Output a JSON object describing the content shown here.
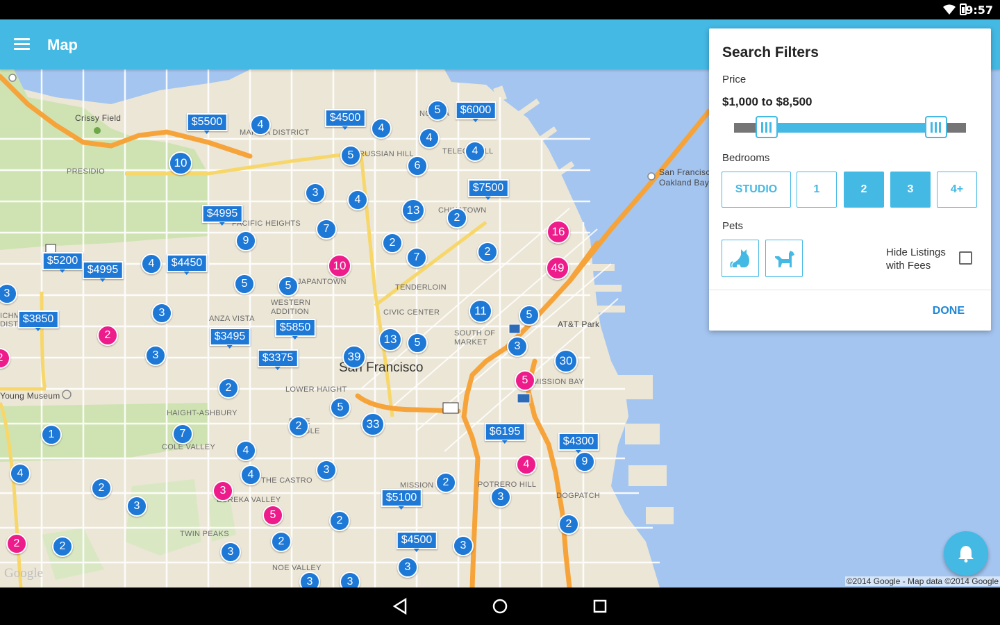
{
  "status_bar": {
    "time": "9:57",
    "icons": [
      "wifi-icon",
      "battery-icon"
    ]
  },
  "app_bar": {
    "title": "Map",
    "menu_icon": "hamburger-menu-icon",
    "color": "#44b9e4"
  },
  "map": {
    "labels": {
      "san_francisco": "San Francisco",
      "crissy_field": "Crissy Field",
      "presidio": "PRESIDIO",
      "marina_district": "MARINA DISTRICT",
      "russian_hill": "RUSSIAN HILL",
      "telegraph_hill": "TELEGR  HILL",
      "north_beach": "NO  BEA",
      "pacific_heights": "PACIFIC HEIGHTS",
      "chinatown": "CHINATOWN",
      "japantown": "JAPANTOWN",
      "tenderloin": "TENDERLOIN",
      "western_addition": "WESTERN\nADDITION",
      "civic_center": "CIVIC CENTER",
      "anza_vista": "ANZA VISTA",
      "south_of_market": "SOUTH OF\nMARKET",
      "att_park": "AT&T Park",
      "mission_bay": "MISSION BAY",
      "lower_haight": "LOWER HAIGHT",
      "haight_ashbury": "HAIGHT-ASHBURY",
      "cole_valley": "COLE VALLEY",
      "duboce_triangle": "D  CE\nT  NGLE",
      "the_castro": "THE CASTRO",
      "eureka_valley": "EUREKA VALLEY",
      "twin_peaks": "TWIN PEAKS",
      "noe_valley": "NOE VALLEY",
      "mission": "MISSION",
      "potrero_hill": "POTRERO HILL",
      "dogpatch": "DOGPATCH",
      "young_museum": "Young Museum",
      "bay_bridge": "San Francisc\nOakland Bay",
      "richmond": "ICHM\nDISTR"
    },
    "markers": [
      {
        "t": "$5500",
        "k": "price",
        "c": "blue"
      },
      {
        "t": "4",
        "k": "count",
        "c": "blue"
      },
      {
        "t": "$4500",
        "k": "price",
        "c": "blue"
      },
      {
        "t": "5",
        "k": "count",
        "c": "blue"
      },
      {
        "t": "$6000",
        "k": "price",
        "c": "blue"
      },
      {
        "t": "4",
        "k": "count",
        "c": "blue"
      },
      {
        "t": "4",
        "k": "count",
        "c": "blue"
      },
      {
        "t": "10",
        "k": "count",
        "c": "blue"
      },
      {
        "t": "5",
        "k": "count",
        "c": "blue"
      },
      {
        "t": "4",
        "k": "count",
        "c": "blue"
      },
      {
        "t": "6",
        "k": "count",
        "c": "blue"
      },
      {
        "t": "$7500",
        "k": "price",
        "c": "blue"
      },
      {
        "t": "3",
        "k": "count",
        "c": "blue"
      },
      {
        "t": "4",
        "k": "count",
        "c": "blue"
      },
      {
        "t": "$4995",
        "k": "price",
        "c": "blue"
      },
      {
        "t": "13",
        "k": "count",
        "c": "blue"
      },
      {
        "t": "7",
        "k": "count",
        "c": "blue"
      },
      {
        "t": "2",
        "k": "count",
        "c": "blue"
      },
      {
        "t": "9",
        "k": "count",
        "c": "blue"
      },
      {
        "t": "2",
        "k": "count",
        "c": "blue"
      },
      {
        "t": "16",
        "k": "count",
        "c": "pink"
      },
      {
        "t": "$5200",
        "k": "price",
        "c": "blue"
      },
      {
        "t": "$4995",
        "k": "price",
        "c": "blue"
      },
      {
        "t": "4",
        "k": "count",
        "c": "blue"
      },
      {
        "t": "$4450",
        "k": "price",
        "c": "blue"
      },
      {
        "t": "10",
        "k": "count",
        "c": "pink"
      },
      {
        "t": "7",
        "k": "count",
        "c": "blue"
      },
      {
        "t": "2",
        "k": "count",
        "c": "blue"
      },
      {
        "t": "49",
        "k": "count",
        "c": "pink"
      },
      {
        "t": "5",
        "k": "count",
        "c": "blue"
      },
      {
        "t": "5",
        "k": "count",
        "c": "blue"
      },
      {
        "t": "3",
        "k": "count",
        "c": "blue"
      },
      {
        "t": "11",
        "k": "count",
        "c": "blue"
      },
      {
        "t": "5",
        "k": "count",
        "c": "blue"
      },
      {
        "t": "3",
        "k": "count",
        "c": "blue"
      },
      {
        "t": "$3850",
        "k": "price",
        "c": "blue"
      },
      {
        "t": "2",
        "k": "count",
        "c": "pink"
      },
      {
        "t": "$5850",
        "k": "price",
        "c": "blue"
      },
      {
        "t": "$3495",
        "k": "price",
        "c": "blue"
      },
      {
        "t": "13",
        "k": "count",
        "c": "blue"
      },
      {
        "t": "5",
        "k": "count",
        "c": "blue"
      },
      {
        "t": "3",
        "k": "count",
        "c": "blue"
      },
      {
        "t": "3",
        "k": "count",
        "c": "blue"
      },
      {
        "t": "$3375",
        "k": "price",
        "c": "blue"
      },
      {
        "t": "39",
        "k": "count",
        "c": "blue"
      },
      {
        "t": "30",
        "k": "count",
        "c": "blue"
      },
      {
        "t": "2",
        "k": "count",
        "c": "pink"
      },
      {
        "t": "5",
        "k": "count",
        "c": "pink"
      },
      {
        "t": "2",
        "k": "count",
        "c": "blue"
      },
      {
        "t": "5",
        "k": "count",
        "c": "blue"
      },
      {
        "t": "33",
        "k": "count",
        "c": "blue"
      },
      {
        "t": "2",
        "k": "count",
        "c": "blue"
      },
      {
        "t": "1",
        "k": "count",
        "c": "blue"
      },
      {
        "t": "7",
        "k": "count",
        "c": "blue"
      },
      {
        "t": "$6195",
        "k": "price",
        "c": "blue"
      },
      {
        "t": "$4300",
        "k": "price",
        "c": "blue"
      },
      {
        "t": "4",
        "k": "count",
        "c": "blue"
      },
      {
        "t": "4",
        "k": "count",
        "c": "pink"
      },
      {
        "t": "9",
        "k": "count",
        "c": "blue"
      },
      {
        "t": "4",
        "k": "count",
        "c": "blue"
      },
      {
        "t": "4",
        "k": "count",
        "c": "blue"
      },
      {
        "t": "3",
        "k": "count",
        "c": "blue"
      },
      {
        "t": "2",
        "k": "count",
        "c": "blue"
      },
      {
        "t": "3",
        "k": "count",
        "c": "pink"
      },
      {
        "t": "2",
        "k": "count",
        "c": "blue"
      },
      {
        "t": "$5100",
        "k": "price",
        "c": "blue"
      },
      {
        "t": "3",
        "k": "count",
        "c": "blue"
      },
      {
        "t": "5",
        "k": "count",
        "c": "pink"
      },
      {
        "t": "3",
        "k": "count",
        "c": "blue"
      },
      {
        "t": "2",
        "k": "count",
        "c": "blue"
      },
      {
        "t": "2",
        "k": "count",
        "c": "blue"
      },
      {
        "t": "2",
        "k": "count",
        "c": "blue"
      },
      {
        "t": "2",
        "k": "count",
        "c": "pink"
      },
      {
        "t": "$4500",
        "k": "price",
        "c": "blue"
      },
      {
        "t": "3",
        "k": "count",
        "c": "blue"
      },
      {
        "t": "2",
        "k": "count",
        "c": "blue"
      },
      {
        "t": "3",
        "k": "count",
        "c": "blue"
      },
      {
        "t": "3",
        "k": "count",
        "c": "blue"
      },
      {
        "t": "3",
        "k": "count",
        "c": "blue"
      },
      {
        "t": "3",
        "k": "count",
        "c": "blue"
      },
      {
        "t": "2",
        "k": "count",
        "c": "pink"
      }
    ],
    "copyright": "©2014 Google - Map data ©2014 Google",
    "google_logo": "Google"
  },
  "filters": {
    "title": "Search Filters",
    "price_label": "Price",
    "price_range": "$1,000 to $8,500",
    "price_min_fraction": 0.14,
    "price_max_fraction": 0.87,
    "bedrooms_label": "Bedrooms",
    "bedroom_options": [
      {
        "label": "STUDIO",
        "selected": false
      },
      {
        "label": "1",
        "selected": false
      },
      {
        "label": "2",
        "selected": true
      },
      {
        "label": "3",
        "selected": true
      },
      {
        "label": "4+",
        "selected": false
      }
    ],
    "pets_label": "Pets",
    "pet_options": [
      "cat-icon",
      "dog-icon"
    ],
    "hide_fees_label": "Hide Listings with Fees",
    "hide_fees_checked": false,
    "done_label": "DONE"
  },
  "fab_icon": "bell-icon",
  "nav_bar": [
    "back-icon",
    "home-icon",
    "recents-icon"
  ]
}
